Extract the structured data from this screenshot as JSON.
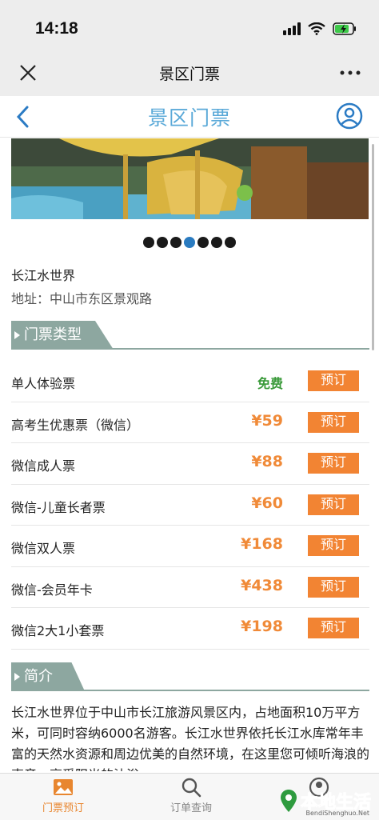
{
  "status_bar": {
    "time": "14:18"
  },
  "wechat_nav": {
    "title": "景区门票"
  },
  "header": {
    "title": "景区门票"
  },
  "carousel": {
    "count": 7,
    "active_index": 3
  },
  "park": {
    "name": "长江水世界",
    "address": "地址：中山市东区景观路"
  },
  "sections": {
    "tickets": "门票类型",
    "intro": "简介"
  },
  "tickets": [
    {
      "name": "单人体验票",
      "price": "免费",
      "button": "预订"
    },
    {
      "name": "高考生优惠票（微信）",
      "price": "¥59",
      "button": "预订"
    },
    {
      "name": "微信成人票",
      "price": "¥88",
      "button": "预订"
    },
    {
      "name": "微信-儿童长者票",
      "price": "¥60",
      "button": "预订"
    },
    {
      "name": "微信双人票",
      "price": "¥168",
      "button": "预订"
    },
    {
      "name": "微信-会员年卡",
      "price": "¥438",
      "button": "预订"
    },
    {
      "name": "微信2大1小套票",
      "price": "¥198",
      "button": "预订"
    }
  ],
  "intro": {
    "text": "长江水世界位于中山市长江旅游风景区内，占地面积10万平方米，可同时容纳6000名游客。长江水世界依托长江水库常年丰富的天然水资源和周边优美的自然环境，在这里您可倾听海浪的声音，享受阳光的沐浴。"
  },
  "tab_bar": {
    "items": [
      "门票预订",
      "订单查询",
      ""
    ]
  },
  "watermark": {
    "text": "本地生活",
    "sub": "BendiShenghuo.Net"
  },
  "colors": {
    "accent": "#f28433",
    "title_blue": "#5aa9d8",
    "section": "#8da7a0",
    "free": "#3a9a3a"
  }
}
